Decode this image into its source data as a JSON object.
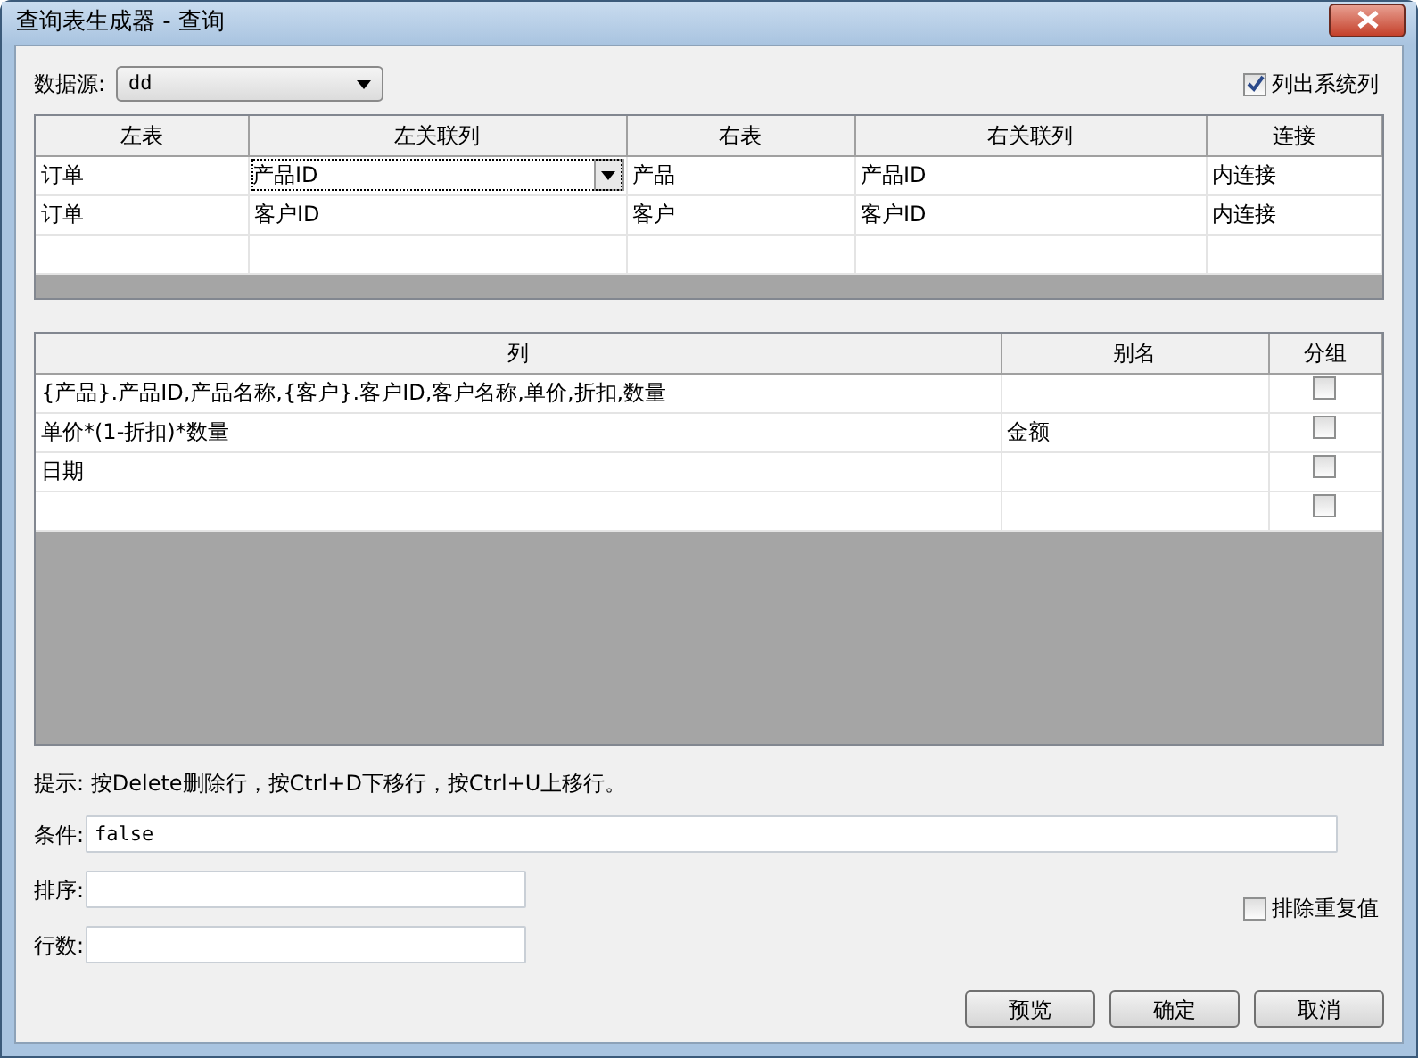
{
  "window": {
    "title": "查询表生成器 - 查询"
  },
  "datasource": {
    "label": "数据源:",
    "value": "dd"
  },
  "list_system_columns": {
    "label": "列出系统列",
    "checked": true
  },
  "join_table": {
    "columns": [
      "左表",
      "左关联列",
      "右表",
      "右关联列",
      "连接"
    ],
    "rows": [
      {
        "cells": [
          {
            "text": "订单",
            "focused": false
          },
          {
            "text": "产品ID",
            "focused": true
          },
          {
            "text": "产品",
            "focused": false
          },
          {
            "text": "产品ID",
            "focused": false
          },
          {
            "text": "内连接",
            "focused": false
          }
        ]
      },
      {
        "cells": [
          {
            "text": "订单",
            "focused": false
          },
          {
            "text": "客户ID",
            "focused": false
          },
          {
            "text": "客户",
            "focused": false
          },
          {
            "text": "客户ID",
            "focused": false
          },
          {
            "text": "内连接",
            "focused": false
          }
        ]
      }
    ]
  },
  "column_table": {
    "columns": [
      "列",
      "别名",
      "分组"
    ],
    "rows": [
      {
        "column": "{产品}.产品ID,产品名称,{客户}.客户ID,客户名称,单价,折扣,数量",
        "group": false
      },
      {
        "column": "单价*(1-折扣)*数量",
        "alias": "金额",
        "group": false
      },
      {
        "column": "日期",
        "group": false
      },
      {
        "group": false
      }
    ]
  },
  "hint": "提示: 按Delete删除行，按Ctrl+D下移行，按Ctrl+U上移行。",
  "condition": {
    "label": "条件:",
    "value": "false"
  },
  "order": {
    "label": "排序:"
  },
  "row_count": {
    "label": "行数:"
  },
  "exclude_duplicates": {
    "label": "排除重复值",
    "checked": false
  },
  "buttons": [
    "预览",
    "确定",
    "取消"
  ]
}
